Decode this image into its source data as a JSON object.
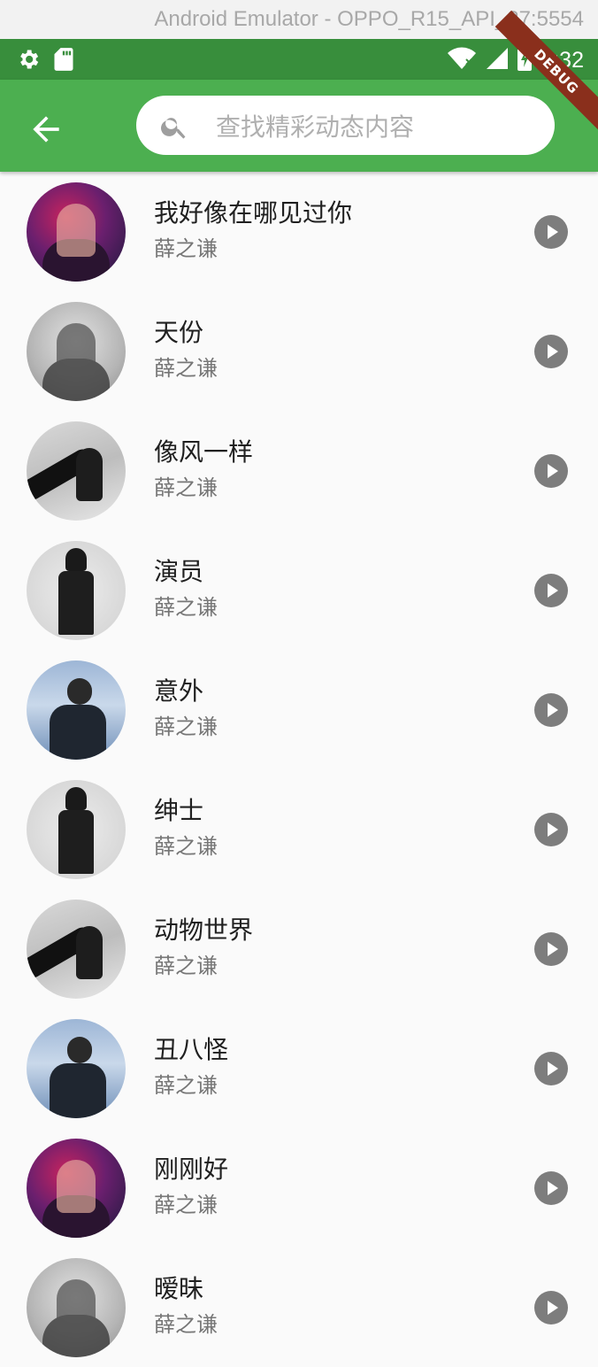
{
  "window": {
    "title": "Android Emulator - OPPO_R15_API_27:5554"
  },
  "status_bar": {
    "time": "3:32",
    "icons": [
      "settings-icon",
      "sd-card-icon",
      "wifi-icon",
      "signal-icon",
      "battery-charging-icon"
    ]
  },
  "app_bar": {
    "back_icon": "arrow-back-icon",
    "search": {
      "placeholder": "查找精彩动态内容",
      "value": ""
    },
    "debug_label": "DEBUG",
    "color": "#4caf50"
  },
  "songs": [
    {
      "title": "我好像在哪见过你",
      "artist": "薛之谦"
    },
    {
      "title": "天份",
      "artist": "薛之谦"
    },
    {
      "title": "像风一样",
      "artist": "薛之谦"
    },
    {
      "title": "演员",
      "artist": "薛之谦"
    },
    {
      "title": "意外",
      "artist": "薛之谦"
    },
    {
      "title": "绅士",
      "artist": "薛之谦"
    },
    {
      "title": "动物世界",
      "artist": "薛之谦"
    },
    {
      "title": "丑八怪",
      "artist": "薛之谦"
    },
    {
      "title": "刚刚好",
      "artist": "薛之谦"
    },
    {
      "title": "暧昧",
      "artist": "薛之谦"
    }
  ]
}
